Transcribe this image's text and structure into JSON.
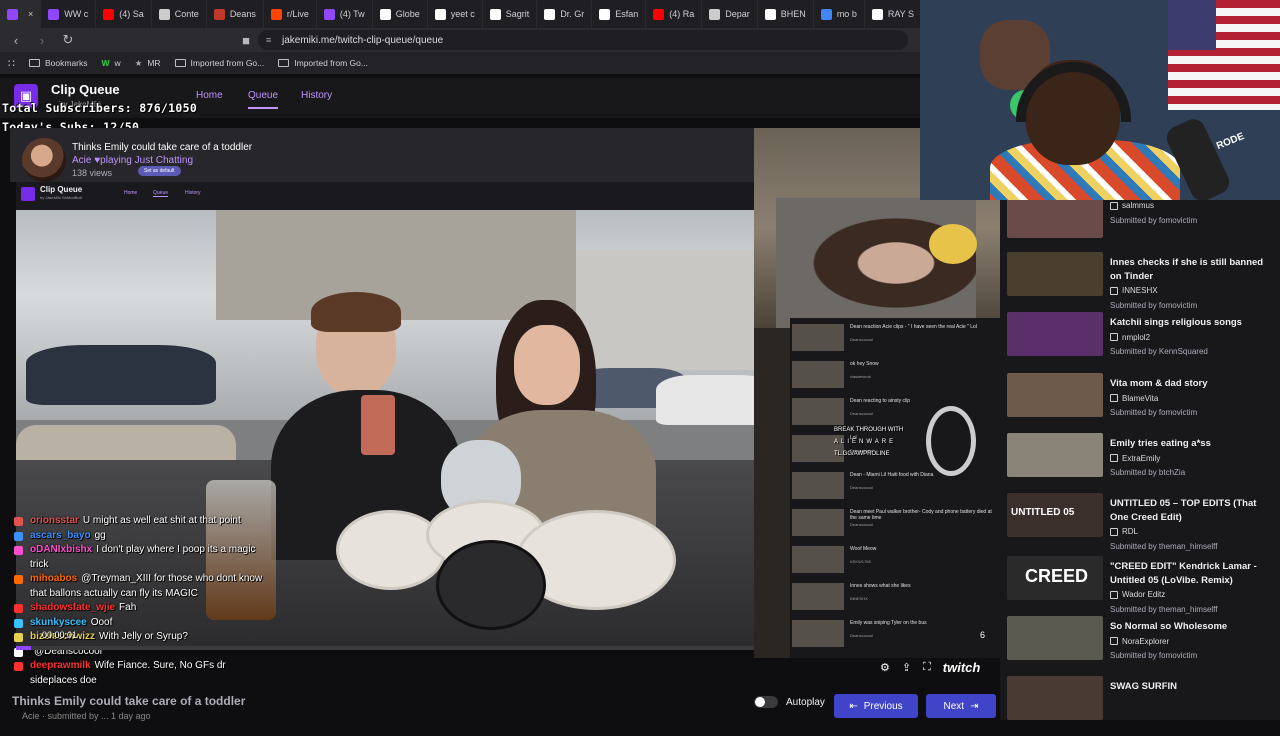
{
  "browser": {
    "tabs": [
      {
        "label": "",
        "color": "#9147ff",
        "active": true
      },
      {
        "label": "WW c",
        "color": "#9147ff"
      },
      {
        "label": "(4) Sa",
        "color": "#ff0000"
      },
      {
        "label": "Conte",
        "color": "#cccccc"
      },
      {
        "label": "Deans",
        "color": "#c0392b"
      },
      {
        "label": "r/Live",
        "color": "#ff4500"
      },
      {
        "label": "(4) Tw",
        "color": "#9147ff"
      },
      {
        "label": "Globe",
        "color": "#ffffff"
      },
      {
        "label": "yeet c",
        "color": "#ffffff"
      },
      {
        "label": "Sagrit",
        "color": "#ffffff"
      },
      {
        "label": "Dr. Gr",
        "color": "#ffffff"
      },
      {
        "label": "Esfan",
        "color": "#ffffff"
      },
      {
        "label": "(4) Ra",
        "color": "#ff0000"
      },
      {
        "label": "Depar",
        "color": "#cccccc"
      },
      {
        "label": "BHEN",
        "color": "#ffffff"
      },
      {
        "label": "mo b",
        "color": "#4285f4"
      },
      {
        "label": "RAY S",
        "color": "#ffffff"
      }
    ],
    "url": "jakemiki.me/twitch-clip-queue/queue",
    "bookmarks": [
      "Bookmarks",
      "w",
      "MR",
      "Imported from Go...",
      "Imported from Go..."
    ]
  },
  "app": {
    "title": "Clip Queue",
    "subtitle": "by JakeMiki",
    "nav": [
      "Home",
      "Queue",
      "History"
    ]
  },
  "overlay": {
    "total_subs": "Total Subscribers: 876/1050",
    "today_subs": "Today's Subs: 12/50"
  },
  "clip": {
    "title": "Thinks Emily could take care of a toddler",
    "author": "Acie",
    "playing": "playing Just Chatting",
    "views": "138 views",
    "set_default": "Set as default",
    "timecode": "00:00:01",
    "progress": 0.02
  },
  "inner_app": {
    "title": "Clip Queue",
    "subtitle": "by JakeMiki  SirMudBott",
    "nav": [
      "Home",
      "Queue",
      "History"
    ]
  },
  "chat": [
    {
      "name": "orionsstar",
      "color": "#e05252",
      "text": "U might as well eat shit at that point"
    },
    {
      "name": "ascars_bayo",
      "color": "#3b8fff",
      "text": "gg"
    },
    {
      "name": "oDANIxbishx",
      "color": "#ff4fd0",
      "text": "I don't play where I poop its a magic trick"
    },
    {
      "name": "mihoabos",
      "color": "#ff6a00",
      "text": "@Treyman_XIII for those who dont know that ballons actually can fly its MAGIC"
    },
    {
      "name": "shadowsfate_wjie",
      "color": "#ff3030",
      "text": "Fah"
    },
    {
      "name": "skunkyscee",
      "color": "#38c2ff",
      "text": "Ooof"
    },
    {
      "name": "bizzleschwizz",
      "color": "#e8d050",
      "text": "With Jelly or Syrup?"
    },
    {
      "name": "",
      "color": "#fff",
      "text": "@Deanscocool"
    },
    {
      "name": "deeprawmilk",
      "color": "#ff3030",
      "text": "Wife Fiance. Sure, No GFs dr sideplaces doe"
    }
  ],
  "mid_list": [
    {
      "title": "Dean reaction Acie clips - \" I have seen the real Acie \" Lol",
      "sub": "Deanscocool"
    },
    {
      "title": "ok hey Snow",
      "sub": "classetwork"
    },
    {
      "title": "Dean reacting to ainsty clip",
      "sub": "Deanscocool"
    },
    {
      "title": "Lol",
      "sub": "Deanscocool"
    },
    {
      "title": "Dean - Miami Lil Haiti food with Diana",
      "sub": "Deanscocool"
    },
    {
      "title": "Dean meet Paul walker brother- Cody and phone battery died at the same time",
      "sub": "Deanscocool"
    },
    {
      "title": "Woof Meow",
      "sub": "KEKW1765"
    },
    {
      "title": "Innes shows what she likes",
      "sub": "INNESHX"
    },
    {
      "title": "Emily was sniping Tyler on the bus",
      "sub": "Deanscocool"
    }
  ],
  "mid_ads": {
    "line1": "BREAK THROUGH WITH",
    "line2": "ALIENWARE",
    "line3": "TL.GG/AWPROLINE"
  },
  "right_list": [
    {
      "title": "",
      "meta": "salmmus",
      "submitted": "Submitted by fomovictim",
      "color": "#6b4a4a"
    },
    {
      "title": "Innes checks if she is still banned on Tinder",
      "meta": "INNESHX",
      "submitted": "Submitted by fomovictim",
      "color": "#4a3f2f"
    },
    {
      "title": "Katchii sings religious songs",
      "meta": "nmplol2",
      "submitted": "Submitted by KennSquared",
      "color": "#5a2f6a"
    },
    {
      "title": "Vita mom & dad story",
      "meta": "BlameVita",
      "submitted": "Submitted by fomovictim",
      "color": "#6e5a4a"
    },
    {
      "title": "Emily tries eating a*ss",
      "meta": "ExtraEmily",
      "submitted": "Submitted by btchZia",
      "color": "#8a8378"
    },
    {
      "title": "UNTITLED 05 – TOP EDITS (That One Creed Edit)",
      "meta": "RDL",
      "submitted": "Submitted by theman_himselff",
      "color": "#3a2f2a"
    },
    {
      "title": "\"CREED EDIT\" Kendrick Lamar - Untitled 05 (LoVibe. Remix)",
      "meta": "Wador Editz",
      "submitted": "Submitted by theman_himselff",
      "color": "#2a2a2a"
    },
    {
      "title": "So Normal so Wholesome",
      "meta": "NoraExplorer",
      "submitted": "Submitted by fomovictim",
      "color": "#5a5a50"
    },
    {
      "title": "SWAG SURFIN",
      "meta": "",
      "submitted": "",
      "color": "#4a3a34"
    }
  ],
  "right_thumbs": {
    "untitled": "UNTITLED 05",
    "creed": "CREED"
  },
  "webcam": {
    "mic_brand": "RODE"
  },
  "controls": {
    "autoplay": "Autoplay",
    "previous": "Previous",
    "next": "Next",
    "volume_num": "6",
    "twitch": "twitch"
  },
  "bottom": {
    "title": "Thinks Emily could take care of a toddler",
    "sub": "Acie · submitted by ... 1 day ago"
  }
}
